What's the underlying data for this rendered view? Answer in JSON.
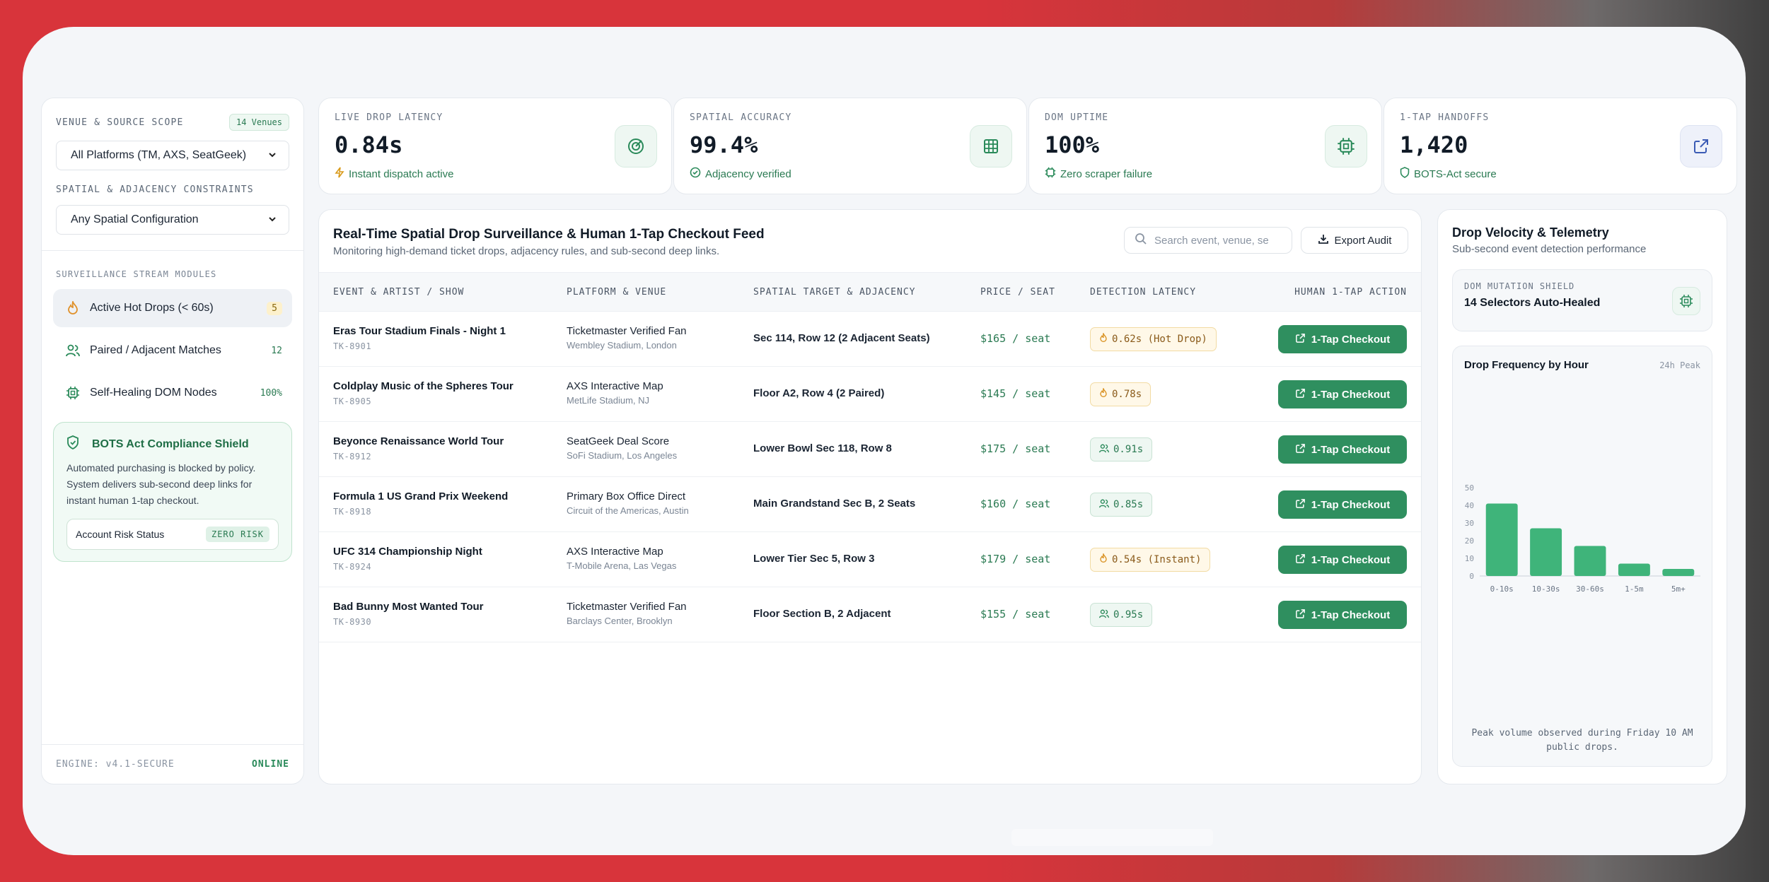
{
  "sidebar": {
    "scope_label": "VENUE & SOURCE SCOPE",
    "venue_badge": "14 Venues",
    "platform_select": "All Platforms (TM, AXS, SeatGeek)",
    "constraints_label": "SPATIAL & ADJACENCY CONSTRAINTS",
    "spatial_select": "Any Spatial Configuration",
    "modules_label": "SURVEILLANCE STREAM MODULES",
    "modules": [
      {
        "label": "Active Hot Drops (< 60s)",
        "count": "5",
        "icon": "flame-icon"
      },
      {
        "label": "Paired / Adjacent Matches",
        "count": "12",
        "icon": "users-icon"
      },
      {
        "label": "Self-Healing DOM Nodes",
        "count": "100%",
        "icon": "cpu-icon"
      }
    ],
    "shield": {
      "title": "BOTS Act Compliance Shield",
      "text": "Automated purchasing is blocked by policy. System delivers sub-second deep links for instant human 1-tap checkout.",
      "risk_label": "Account Risk Status",
      "risk_badge": "ZERO RISK"
    },
    "engine": "ENGINE: v4.1-SECURE",
    "status": "ONLINE"
  },
  "kpis": [
    {
      "label": "LIVE DROP LATENCY",
      "value": "0.84s",
      "sub": "Instant dispatch active",
      "icon": "radar-icon"
    },
    {
      "label": "SPATIAL ACCURACY",
      "value": "99.4%",
      "sub": "Adjacency verified",
      "icon": "grid-icon"
    },
    {
      "label": "DOM UPTIME",
      "value": "100%",
      "sub": "Zero scraper failure",
      "icon": "cpu-icon"
    },
    {
      "label": "1-TAP HANDOFFS",
      "value": "1,420",
      "sub": "BOTS-Act secure",
      "icon": "external-link-icon"
    }
  ],
  "feed": {
    "title": "Real-Time Spatial Drop Surveillance & Human 1-Tap Checkout Feed",
    "subtitle": "Monitoring high-demand ticket drops, adjacency rules, and sub-second deep links.",
    "search_placeholder": "Search event, venue, se",
    "export_label": "Export Audit",
    "columns": [
      "EVENT & ARTIST / SHOW",
      "PLATFORM & VENUE",
      "SPATIAL TARGET & ADJACENCY",
      "PRICE / SEAT",
      "DETECTION LATENCY",
      "HUMAN 1-TAP ACTION"
    ],
    "rows": [
      {
        "event": "Eras Tour Stadium Finals - Night 1",
        "id": "TK-8901",
        "platform": "Ticketmaster Verified Fan",
        "venue": "Wembley Stadium, London",
        "spatial": "Sec 114, Row 12 (2 Adjacent Seats)",
        "price": "$165 / seat",
        "latency": "0.62s (Hot Drop)",
        "lat_type": "hot",
        "action": "1-Tap Checkout"
      },
      {
        "event": "Coldplay Music of the Spheres Tour",
        "id": "TK-8905",
        "platform": "AXS Interactive Map",
        "venue": "MetLife Stadium, NJ",
        "spatial": "Floor A2, Row 4 (2 Paired)",
        "price": "$145 / seat",
        "latency": "0.78s",
        "lat_type": "hot",
        "action": "1-Tap Checkout"
      },
      {
        "event": "Beyonce Renaissance World Tour",
        "id": "TK-8912",
        "platform": "SeatGeek Deal Score",
        "venue": "SoFi Stadium, Los Angeles",
        "spatial": "Lower Bowl Sec 118, Row 8",
        "price": "$175 / seat",
        "latency": "0.91s",
        "lat_type": "pair",
        "action": "1-Tap Checkout"
      },
      {
        "event": "Formula 1 US Grand Prix Weekend",
        "id": "TK-8918",
        "platform": "Primary Box Office Direct",
        "venue": "Circuit of the Americas, Austin",
        "spatial": "Main Grandstand Sec B, 2 Seats",
        "price": "$160 / seat",
        "latency": "0.85s",
        "lat_type": "pair",
        "action": "1-Tap Checkout"
      },
      {
        "event": "UFC 314 Championship Night",
        "id": "TK-8924",
        "platform": "AXS Interactive Map",
        "venue": "T-Mobile Arena, Las Vegas",
        "spatial": "Lower Tier Sec 5, Row 3",
        "price": "$179 / seat",
        "latency": "0.54s (Instant)",
        "lat_type": "hot",
        "action": "1-Tap Checkout"
      },
      {
        "event": "Bad Bunny Most Wanted Tour",
        "id": "TK-8930",
        "platform": "Ticketmaster Verified Fan",
        "venue": "Barclays Center, Brooklyn",
        "spatial": "Floor Section B, 2 Adjacent",
        "price": "$155 / seat",
        "latency": "0.95s",
        "lat_type": "pair",
        "action": "1-Tap Checkout"
      }
    ]
  },
  "telemetry": {
    "title": "Drop Velocity & Telemetry",
    "subtitle": "Sub-second event detection performance",
    "dom_label": "DOM MUTATION SHIELD",
    "dom_value": "14 Selectors Auto-Healed",
    "freq_title": "Drop Frequency by Hour",
    "freq_peak": "24h Peak",
    "note": "Peak volume observed during Friday 10 AM public drops."
  },
  "chart_data": {
    "type": "bar",
    "categories": [
      "0-10s",
      "10-30s",
      "30-60s",
      "1-5m",
      "5m+"
    ],
    "values": [
      41,
      27,
      17,
      7,
      4
    ],
    "yticks": [
      0,
      10,
      20,
      30,
      40,
      50
    ],
    "ylim": [
      0,
      50
    ],
    "bar_color": "#3fb47a"
  },
  "colors": {
    "accent": "#2f8f5f",
    "brand_bg": "#d8343b"
  }
}
